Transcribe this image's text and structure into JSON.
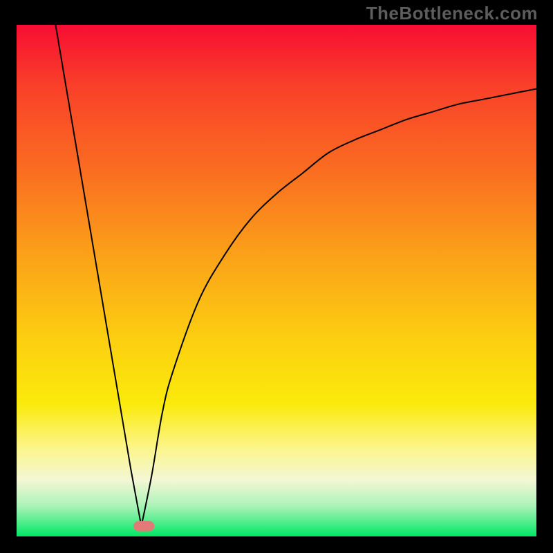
{
  "attribution": "TheBottleneck.com",
  "gradient_colors": {
    "top": "#F70D32",
    "mid_high": "#FA6C21",
    "mid": "#FCD010",
    "mid_low": "#FCF58E",
    "bottom": "#00E765"
  },
  "chart_data": {
    "type": "line",
    "title": "",
    "xlabel": "",
    "ylabel": "",
    "xlim": [
      0,
      100
    ],
    "ylim": [
      0,
      100
    ],
    "series": [
      {
        "name": "curve",
        "comment": "Bottleneck-style V curve: steep linear descent from (≈7.5,100) to minimum near x≈24, y≈2, then asymptotic rise toward (100,≈88).",
        "x": [
          7.5,
          10,
          15,
          20,
          22,
          24,
          26,
          28,
          30,
          35,
          40,
          45,
          50,
          55,
          60,
          65,
          70,
          75,
          80,
          85,
          90,
          95,
          100
        ],
        "values": [
          100,
          85,
          55,
          25,
          13,
          2,
          12,
          24,
          32,
          46,
          55,
          62,
          67,
          71,
          75,
          77.5,
          79.5,
          81.5,
          83,
          84.5,
          85.5,
          86.5,
          87.5
        ]
      }
    ],
    "marker": {
      "comment": "Pinkish rounded bar at curve minimum",
      "x": 24.5,
      "y": 2,
      "width": 4,
      "height": 2,
      "color": "#E27A77"
    }
  }
}
